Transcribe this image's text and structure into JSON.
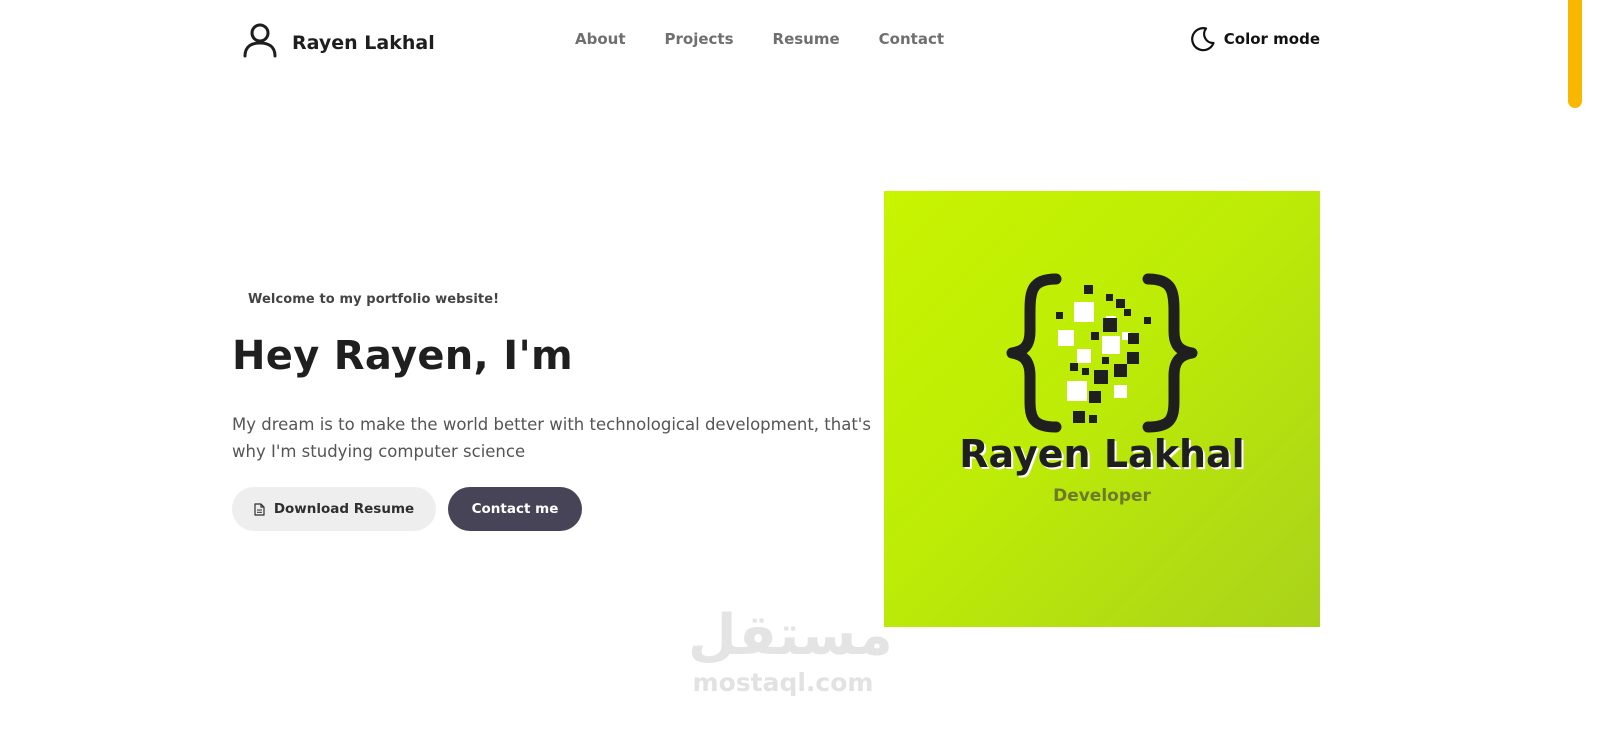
{
  "header": {
    "brand_name": "Rayen Lakhal",
    "nav": [
      {
        "label": "About"
      },
      {
        "label": "Projects"
      },
      {
        "label": "Resume"
      },
      {
        "label": "Contact"
      }
    ],
    "color_mode_label": "Color mode"
  },
  "hero": {
    "welcome": "Welcome to my portfolio website!",
    "headline": "Hey Rayen, I'm",
    "tagline": "My dream is to make the world better with technological development, that's why I'm studying computer science",
    "download_label": "Download Resume",
    "contact_label": "Contact me"
  },
  "logo": {
    "name": "Rayen Lakhal",
    "role": "Developer",
    "background_color": "#c2ee04"
  },
  "watermark": {
    "arabic": "مستقل",
    "latin": "mostaql.com"
  },
  "icons": {
    "brand": "user-icon",
    "color_mode": "moon-icon",
    "download": "document-icon"
  },
  "colors": {
    "accent": "#f8b800",
    "contact_button": "#474458",
    "download_button": "#eeeeee"
  }
}
